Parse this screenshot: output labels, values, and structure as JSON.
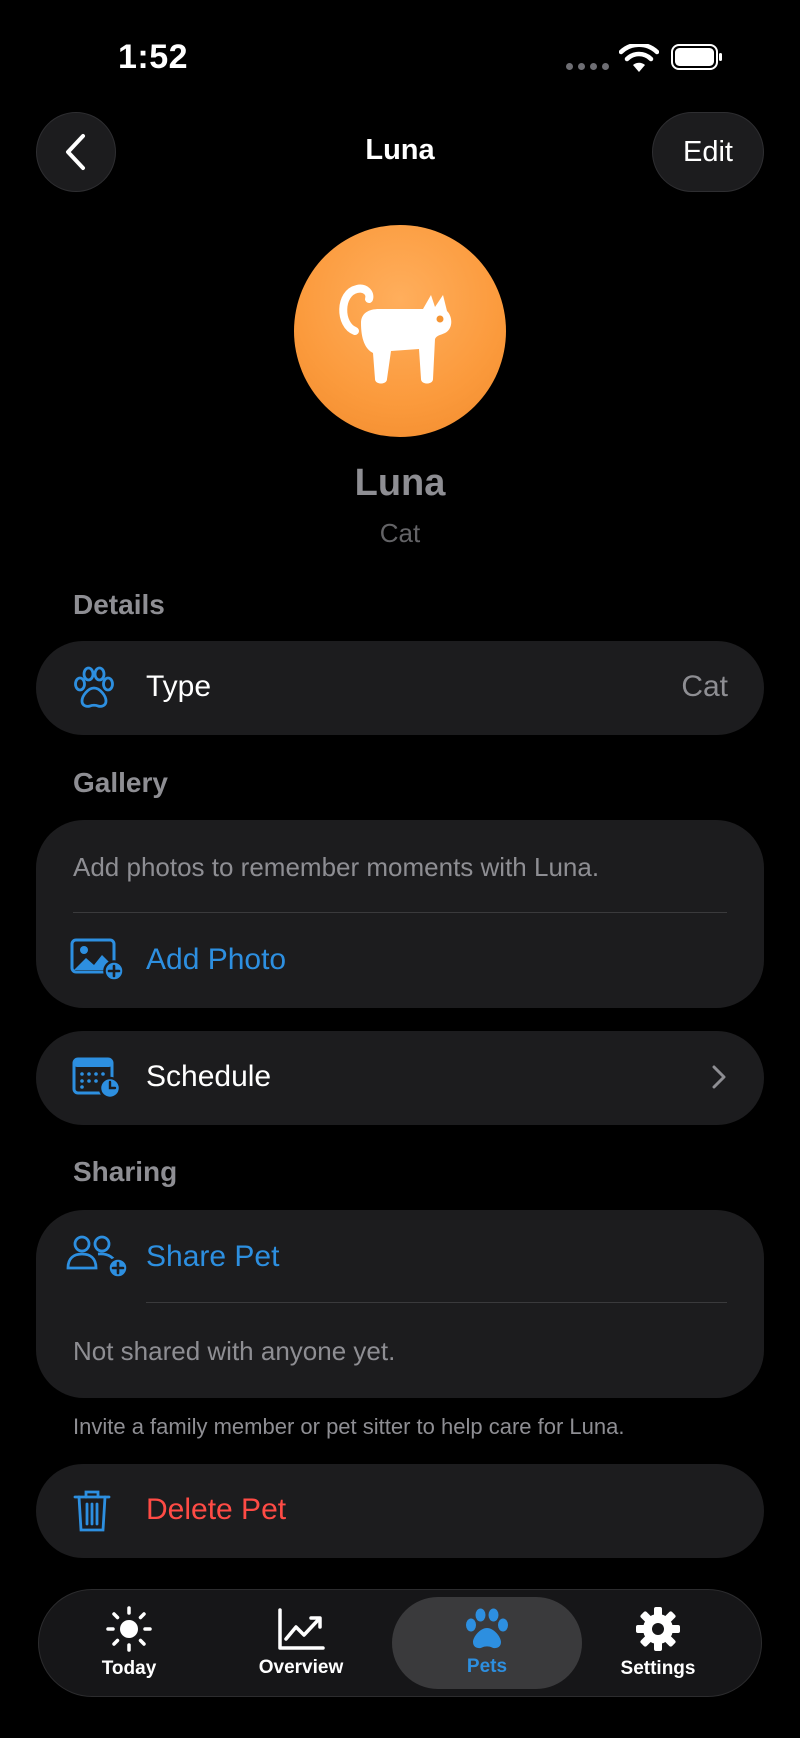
{
  "status_bar": {
    "time": "1:52"
  },
  "nav": {
    "title": "Luna",
    "edit_label": "Edit"
  },
  "pet": {
    "name": "Luna",
    "type": "Cat"
  },
  "details": {
    "header": "Details",
    "type_label": "Type",
    "type_value": "Cat"
  },
  "gallery": {
    "header": "Gallery",
    "description": "Add photos to remember moments with Luna.",
    "add_photo_label": "Add Photo"
  },
  "schedule": {
    "label": "Schedule"
  },
  "sharing": {
    "header": "Sharing",
    "share_label": "Share Pet",
    "status": "Not shared with anyone yet.",
    "footer": "Invite a family member or pet sitter to help care for Luna."
  },
  "delete": {
    "label": "Delete Pet"
  },
  "tabs": [
    {
      "label": "Today",
      "icon": "sun-icon"
    },
    {
      "label": "Overview",
      "icon": "chart-icon"
    },
    {
      "label": "Pets",
      "icon": "paw-icon",
      "active": true
    },
    {
      "label": "Settings",
      "icon": "gear-icon"
    }
  ],
  "colors": {
    "accent": "#2d8fe0",
    "destructive": "#ff4b45",
    "avatar": "#fb9a3c"
  }
}
